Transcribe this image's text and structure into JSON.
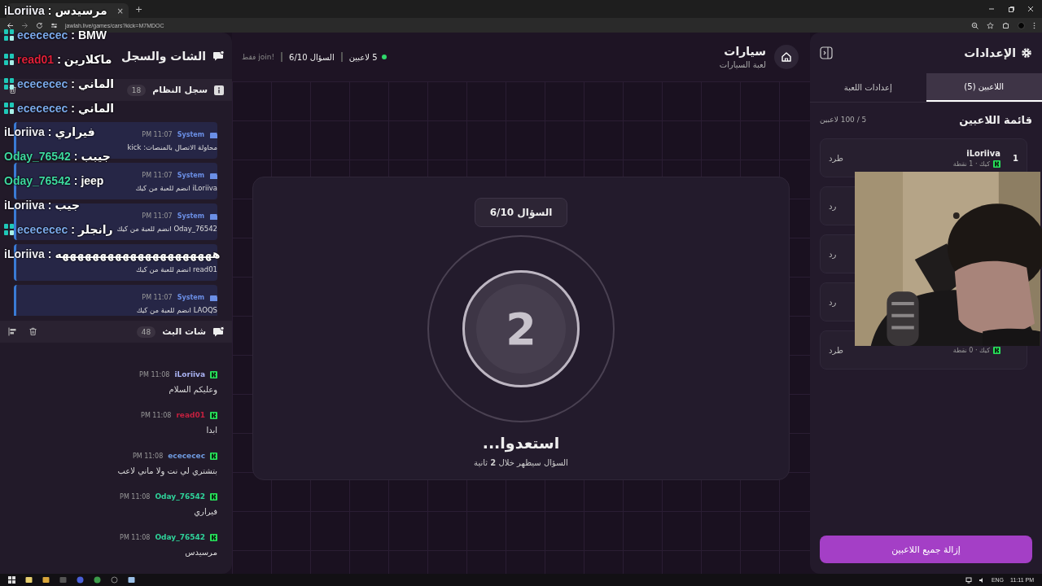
{
  "browser": {
    "tab_close": "×",
    "new_tab": "+",
    "url": "jawlah.live/games/cars?kick=M7MDOC"
  },
  "left_panel": {
    "title": "الشات والسجل",
    "system_log": {
      "title": "سجل النظام",
      "count": "18",
      "entries": [
        {
          "sender": "System",
          "time": "11:07 PM",
          "text": "محاولة الاتصال بالمنصات: kick"
        },
        {
          "sender": "System",
          "time": "11:07 PM",
          "text": "iLoriiva انضم للعبة من كيك"
        },
        {
          "sender": "System",
          "time": "11:07 PM",
          "text": "Oday_76542 انضم للعبة من كيك"
        },
        {
          "text": "read01 انضم للعبة من كيك"
        },
        {
          "sender": "System",
          "time": "11:07 PM",
          "text": "LAOQS انضم للعبة من كيك"
        }
      ]
    },
    "stream_chat": {
      "title": "شات البث",
      "count": "48",
      "messages": [
        {
          "user": "iLoriiva",
          "color": "#a9b2f2",
          "time": "11:08 PM",
          "text": "وعليكم السلام"
        },
        {
          "user": "read01",
          "color": "#c3203f",
          "time": "11:08 PM",
          "text": "ابدا"
        },
        {
          "user": "ecececec",
          "color": "#6f9be0",
          "time": "11:08 PM",
          "text": "بتشتري لي نت ولا ماني لاعب"
        },
        {
          "user": "Oday_76542",
          "color": "#2fd39a",
          "time": "11:08 PM",
          "text": "فيراري"
        },
        {
          "user": "Oday_76542",
          "color": "#2fd39a",
          "time": "11:08 PM",
          "text": "مرسيدس"
        }
      ]
    }
  },
  "header": {
    "title": "سيارات",
    "subtitle": "لعبة السيارات",
    "players": "5 لاعبين",
    "question": "السؤال 6/10",
    "join": "!join فقط"
  },
  "countdown": {
    "badge": "السؤال 6/10",
    "number": "2",
    "heading": "استعدوا...",
    "note": "السؤال سيظهر خلال **2** ثانية"
  },
  "settings": {
    "title": "الإعدادات",
    "tabs": [
      {
        "label": "اللاعبين (5)",
        "selected": true
      },
      {
        "label": "إعدادات اللعبة",
        "selected": false
      }
    ],
    "list_title": "قائمة اللاعبين",
    "capacity": "5 / 100 لاعبين",
    "players": [
      {
        "rank": "1",
        "name": "iLoriiva",
        "meta": "كيك · 1 نقطة",
        "kick": "طرد"
      },
      {
        "kick": "رد"
      },
      {
        "kick": "رد"
      },
      {
        "kick": "رد"
      },
      {
        "meta": "كيك · 0 نقطة",
        "kick": "طرد"
      }
    ],
    "clear_button": "إزالة جميع اللاعبين"
  },
  "overlay_chat": [
    {
      "user": "iLoriiva",
      "color": "#eeeef4",
      "badge": false,
      "separator": ":",
      "text": "مرسيدس"
    },
    {
      "user": "ecececec",
      "color": "#7aa8e8",
      "badge": true,
      "separator": ":",
      "text": "BMW"
    },
    {
      "user": "read01",
      "color": "#e0203a",
      "badge": true,
      "separator": ":",
      "text": "ماكلارين"
    },
    {
      "user": "ecececec",
      "color": "#7aa8e8",
      "badge": true,
      "separator": ":",
      "text": "الماني"
    },
    {
      "user": "ecececec",
      "color": "#7aa8e8",
      "badge": true,
      "separator": ":",
      "text": "الماني"
    },
    {
      "user": "iLoriiva",
      "color": "#eeeef4",
      "badge": false,
      "separator": ":",
      "text": "فيراري"
    },
    {
      "user": "Oday_76542",
      "color": "#3ed8a0",
      "badge": false,
      "separator": ":",
      "text": "جيبب"
    },
    {
      "user": "Oday_76542",
      "color": "#3ed8a0",
      "badge": false,
      "separator": ":",
      "text": "jeep"
    },
    {
      "user": "iLoriiva",
      "color": "#eeeef4",
      "badge": false,
      "separator": ":",
      "text": "جيب"
    },
    {
      "user": "ecececec",
      "color": "#7aa8e8",
      "badge": true,
      "separator": ":",
      "text": "رانجلر"
    },
    {
      "user": "iLoriiva",
      "color": "#eeeef4",
      "badge": false,
      "separator": ":",
      "text": "هههههههههههههههههههههه"
    }
  ],
  "taskbar": {
    "language": "ENG",
    "time": "11:11 PM"
  }
}
